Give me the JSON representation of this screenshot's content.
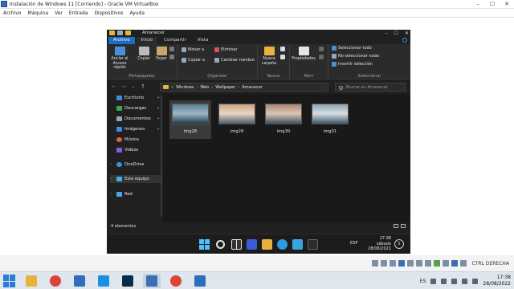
{
  "host": {
    "window_title": "Instalación de Windows 11 [Corriendo] - Oracle VM VirtualBox",
    "window_buttons": {
      "minimize": "–",
      "maximize": "☐",
      "close": "✕"
    },
    "menu": [
      "Archivo",
      "Máquina",
      "Ver",
      "Entrada",
      "Dispositivos",
      "Ayuda"
    ],
    "status_bar": {
      "host_key": "CTRL DERECHA"
    },
    "taskbar": {
      "apps": [
        {
          "name": "file-explorer",
          "color": "#e8b23c"
        },
        {
          "name": "chrome",
          "color": "#db4437"
        },
        {
          "name": "virtualbox",
          "color": "#2f6dbd"
        },
        {
          "name": "unknown-blue-app",
          "color": "#1d8fe0"
        },
        {
          "name": "photoshop",
          "color": "#0b2a4a"
        },
        {
          "name": "virtualbox-vm",
          "color": "#3a6fb2"
        },
        {
          "name": "chrome-2",
          "color": "#db4437"
        },
        {
          "name": "virtualbox-2",
          "color": "#2f6dbd"
        }
      ],
      "language": "ES",
      "time": "17:38",
      "date": "28/08/2022"
    }
  },
  "guest": {
    "explorer": {
      "title": "Amanecer",
      "window_buttons": {
        "minimize": "–",
        "maximize": "☐",
        "close": "✕"
      },
      "tabs": [
        "Archivo",
        "Inicio",
        "Compartir",
        "Vista"
      ],
      "current_tab_index": 1,
      "ribbon": {
        "portapapeles": {
          "label": "Portapapeles",
          "pin": "Anclar al\nAcceso rápido",
          "copy": "Copiar",
          "paste": "Pegar"
        },
        "organizar": {
          "label": "Organizar",
          "move_to": "Mover a",
          "copy_to": "Copiar a",
          "delete": "Eliminar",
          "rename": "Cambiar nombre"
        },
        "nuevo": {
          "label": "Nuevo",
          "new_folder": "Nueva\ncarpeta"
        },
        "abrir": {
          "label": "Abrir",
          "properties": "Propiedades"
        },
        "seleccionar": {
          "label": "Seleccionar",
          "select_all": "Seleccionar todo",
          "select_none": "No seleccionar nada",
          "invert": "Invertir selección"
        }
      },
      "address": {
        "path": [
          "Windows",
          "Web",
          "Wallpaper",
          "Amanecer"
        ],
        "search_placeholder": "Buscar en Amanecer"
      },
      "nav_pane": [
        {
          "label": "Escritorio",
          "icon": "desktop-icon",
          "color": "#3b8de0",
          "pinned": true
        },
        {
          "label": "Descargas",
          "icon": "downloads-icon",
          "color": "#3fa35a",
          "pinned": true
        },
        {
          "label": "Documentos",
          "icon": "documents-icon",
          "color": "#9aa7b8",
          "pinned": true
        },
        {
          "label": "Imágenes",
          "icon": "pictures-icon",
          "color": "#3b8de0",
          "pinned": true
        },
        {
          "label": "Música",
          "icon": "music-icon",
          "color": "#e0613b",
          "pinned": false
        },
        {
          "label": "Videos",
          "icon": "videos-icon",
          "color": "#8a5cd6",
          "pinned": false
        },
        {
          "label": "OneDrive",
          "icon": "onedrive-icon",
          "color": "#3b8de0",
          "pinned": false
        },
        {
          "label": "Este equipo",
          "icon": "this-pc-icon",
          "color": "#4aa8e8",
          "pinned": false,
          "selected": true
        },
        {
          "label": "Red",
          "icon": "network-icon",
          "color": "#4aa8e8",
          "pinned": false
        }
      ],
      "files": [
        {
          "name": "img28",
          "selected": true,
          "colors": [
            "#5d7f95",
            "#9bb7c6",
            "#1f3a4a"
          ]
        },
        {
          "name": "img29",
          "selected": false,
          "colors": [
            "#c9a27e",
            "#e8d7c4",
            "#4e5d68"
          ]
        },
        {
          "name": "img30",
          "selected": false,
          "colors": [
            "#a98772",
            "#dcc6b6",
            "#3f4f5a"
          ]
        },
        {
          "name": "img31",
          "selected": false,
          "colors": [
            "#8fa3b1",
            "#d6dee4",
            "#3b5566"
          ]
        }
      ],
      "status": {
        "item_count": "4 elementos"
      }
    },
    "taskbar": {
      "language": "ESP",
      "time": "17:38",
      "day": "sábado",
      "date": "28/08/2021",
      "notifications": "5"
    }
  }
}
